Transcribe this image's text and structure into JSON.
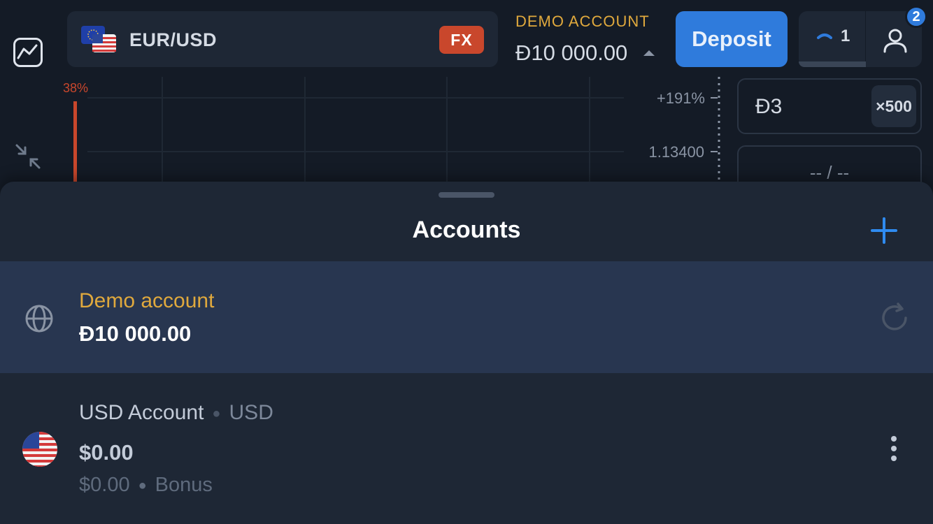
{
  "header": {
    "pair": "EUR/USD",
    "pair_badge": "FX",
    "account_type": "DEMO ACCOUNT",
    "account_balance": "Đ10 000.00",
    "deposit_label": "Deposit",
    "open_trades_count": "1",
    "notification_count": "2"
  },
  "chart": {
    "sentiment_pct": "38%",
    "profit_pct": "+191%",
    "price": "1.13400"
  },
  "trade_panel": {
    "amount": "Đ3",
    "multiplier": "×500",
    "time": "-- / --"
  },
  "sheet": {
    "title": "Accounts",
    "accounts": [
      {
        "name": "Demo account",
        "balance": "Đ10 000.00",
        "icon": "globe-icon",
        "selected": true
      },
      {
        "name": "USD Account",
        "currency": "USD",
        "balance": "$0.00",
        "bonus_amount": "$0.00",
        "bonus_label": "Bonus",
        "icon": "us-flag-icon"
      }
    ]
  },
  "colors": {
    "accent": "#2f7bdc",
    "demo_gold": "#e0a93d",
    "fx_badge": "#c9472c",
    "background": "#141b26",
    "sheet": "#1e2735",
    "selected_row": "#283650"
  }
}
